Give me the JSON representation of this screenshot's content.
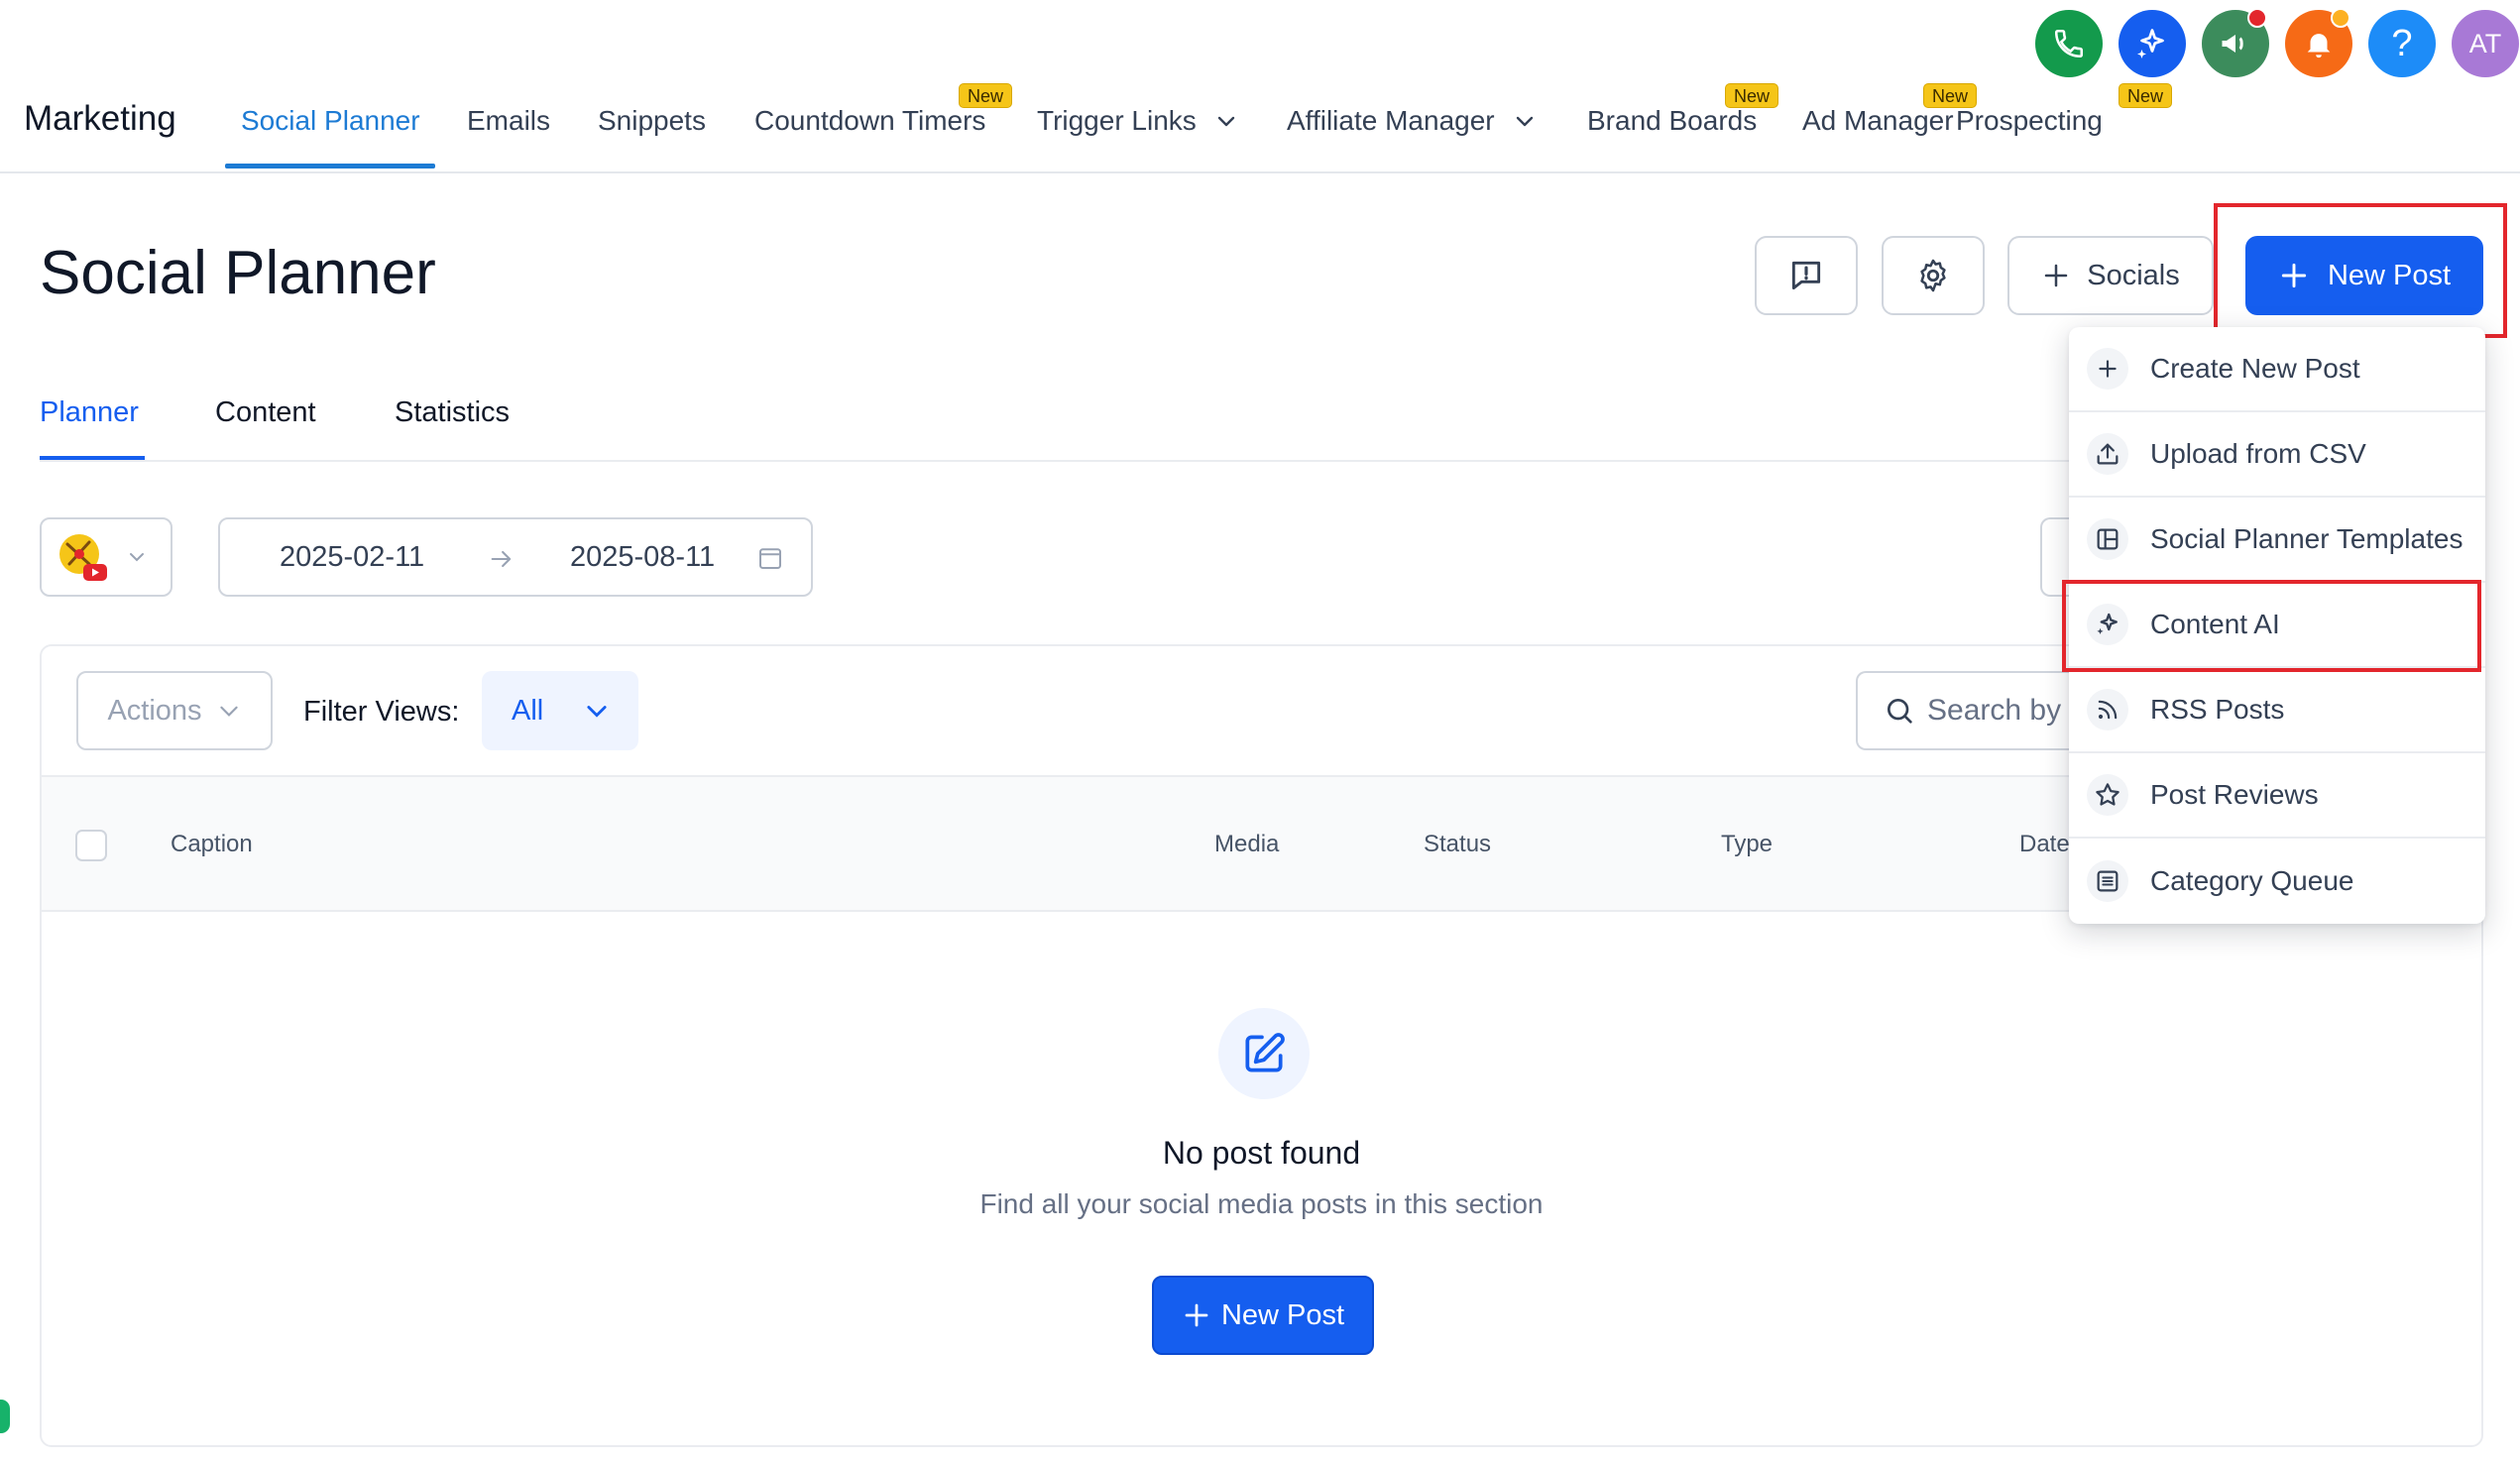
{
  "brand": "Marketing",
  "nav": {
    "items": [
      {
        "label": "Social Planner",
        "active": true
      },
      {
        "label": "Emails"
      },
      {
        "label": "Snippets"
      },
      {
        "label": "Countdown Timers",
        "badge": "New"
      },
      {
        "label": "Trigger Links"
      },
      {
        "label": "Affiliate Manager"
      },
      {
        "label": "Brand Boards",
        "badge": "New"
      },
      {
        "label": "Ad Manager",
        "badge": "New"
      },
      {
        "label": "Prospecting",
        "badge": "New"
      }
    ],
    "badge_text": "New"
  },
  "top_icons": {
    "avatar_initials": "AT",
    "help_label": "?",
    "colors": {
      "phone": "#139a4c",
      "ai": "#155eef",
      "announce": "#3c8c5c",
      "bell": "#f66a16",
      "help": "#1d8cf8",
      "avatar": "#a879d6"
    }
  },
  "header": {
    "title": "Social Planner",
    "socials_label": "Socials",
    "new_post_label": "New Post"
  },
  "tabs": [
    "Planner",
    "Content",
    "Statistics"
  ],
  "filters": {
    "date_start": "2025-02-11",
    "date_end": "2025-08-11"
  },
  "table": {
    "actions_label": "Actions",
    "filter_views_label": "Filter Views:",
    "filter_value": "All",
    "search_placeholder": "Search by",
    "columns": [
      "Caption",
      "Media",
      "Status",
      "Type",
      "Date"
    ]
  },
  "empty_state": {
    "title": "No post found",
    "subtitle": "Find all your social media posts in this section",
    "button_label": "New Post"
  },
  "dropdown": {
    "items": [
      {
        "label": "Create New Post",
        "icon": "plus-icon"
      },
      {
        "label": "Upload from CSV",
        "icon": "upload-icon"
      },
      {
        "label": "Social Planner Templates",
        "icon": "template-icon"
      },
      {
        "label": "Content AI",
        "icon": "sparkle-icon",
        "highlighted": true
      },
      {
        "label": "RSS Posts",
        "icon": "rss-icon"
      },
      {
        "label": "Post Reviews",
        "icon": "star-icon"
      },
      {
        "label": "Category Queue",
        "icon": "list-icon"
      }
    ]
  },
  "accent_color": "#155eef"
}
